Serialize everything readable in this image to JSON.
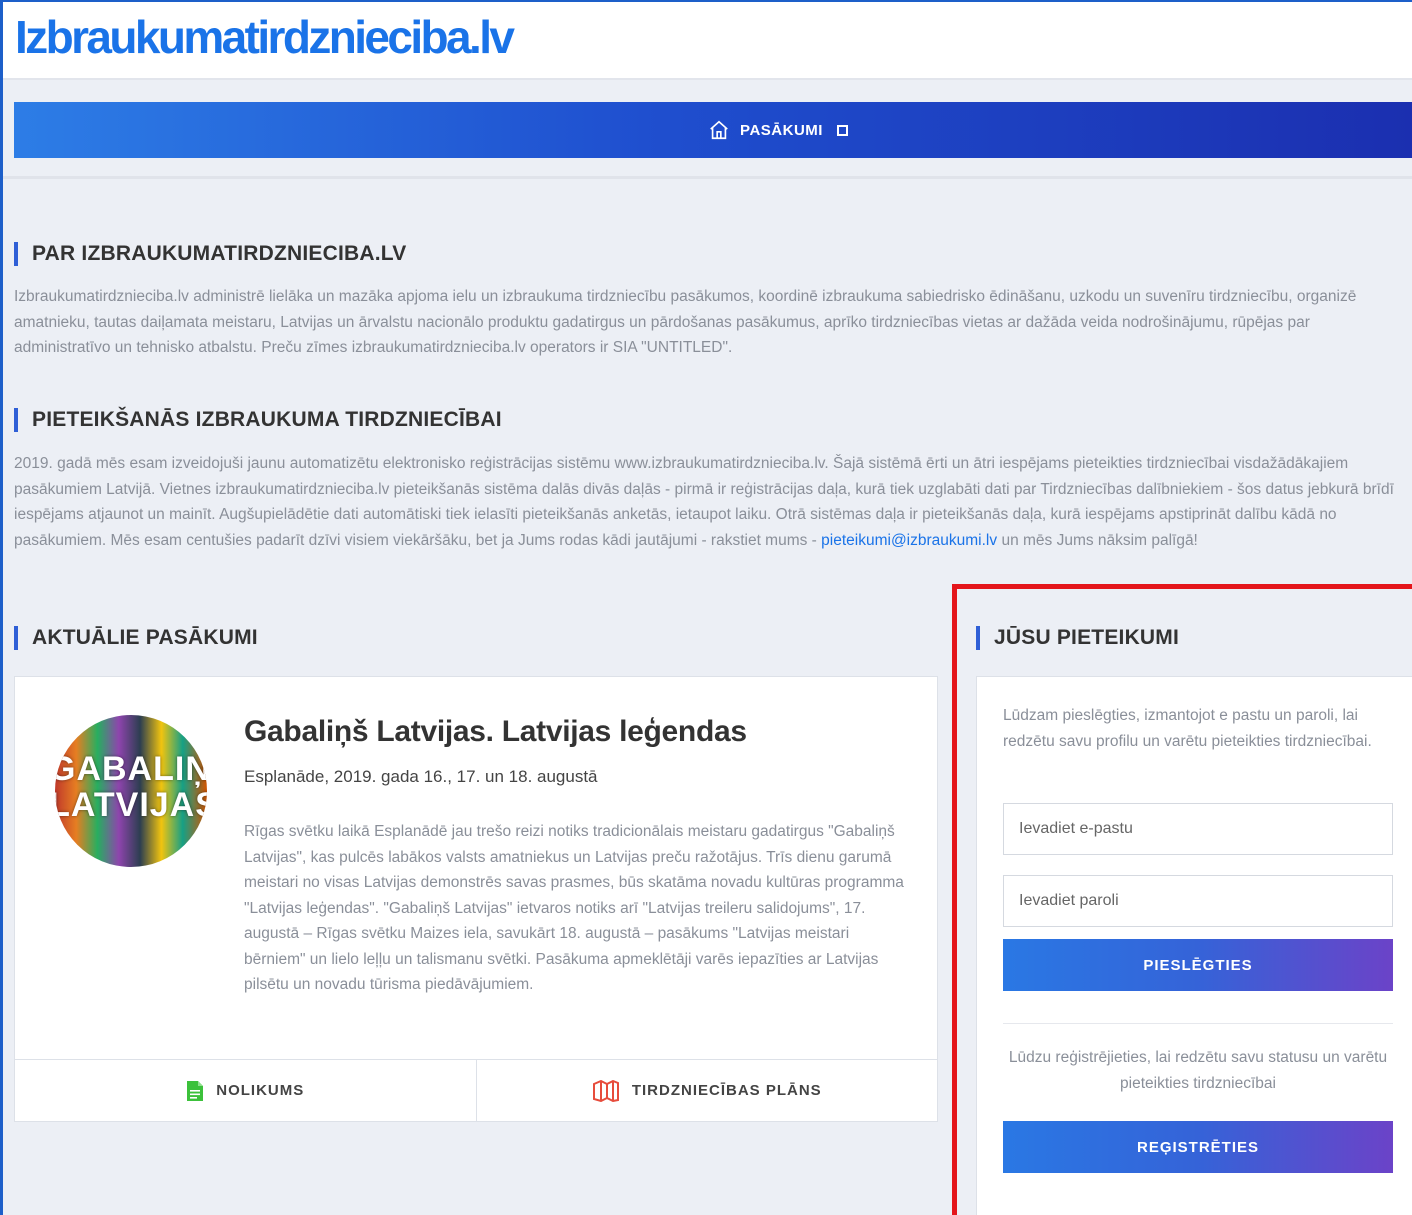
{
  "site": {
    "logo": "Izbraukumatirdznieciba.lv"
  },
  "nav": {
    "items": [
      {
        "label": "PASĀKUMI",
        "icon": "home-icon"
      }
    ]
  },
  "about": {
    "title": "PAR IZBRAUKUMATIRDZNIECIBA.LV",
    "text": "Izbraukumatirdznieciba.lv administrē lielāka un mazāka apjoma ielu un izbraukuma tirdzniecību pasākumos, koordinē izbraukuma sabiedrisko ēdināšanu, uzkodu un suvenīru tirdzniecību, organizē amatnieku, tautas daiļamata meistaru, Latvijas un ārvalstu nacionālo produktu gadatirgus un pārdošanas pasākumus, aprīko tirdzniecības vietas ar dažāda veida nodrošinājumu, rūpējas par administratīvo un tehnisko atbalstu. Preču zīmes izbraukumatirdznieciba.lv operators ir SIA \"UNTITLED\"."
  },
  "signup": {
    "title": "PIETEIKŠANĀS IZBRAUKUMA TIRDZNIECĪBAI",
    "text": "2019. gadā mēs esam izveidojuši jaunu automatizētu elektronisko reģistrācijas sistēmu www.izbraukumatirdznieciba.lv. Šajā sistēmā ērti un ātri iespējams pieteikties tirdzniecībai visdažādākajiem pasākumiem Latvijā. Vietnes izbraukumatirdznieciba.lv pieteikšanās sistēma dalās divās daļās - pirmā ir reģistrācijas daļa, kurā tiek uzglabāti dati par Tirdzniecības dalībniekiem - šos datus jebkurā brīdī iespējams atjaunot un mainīt. Augšupielādētie dati automātiski tiek ielasīti pieteikšanās anketās, ietaupot laiku. Otrā sistēmas daļa ir pieteikšanās daļa, kurā iespējams apstiprināt dalību kādā no pasākumiem. Mēs esam centušies padarīt dzīvi visiem viekāršāku, bet ja Jums rodas kādi jautājumi - rakstiet mums -",
    "email": "pieteikumi@izbraukumi.lv",
    "text_end": "un mēs Jums nāksim palīgā!"
  },
  "events": {
    "title": "AKTUĀLIE PASĀKUMI",
    "items": [
      {
        "image_text": "GABALIŅŠ LATVIJAS",
        "title": "Gabaliņš Latvijas. Latvijas leģendas",
        "subtitle": "Esplanāde, 2019. gada 16., 17. un 18. augustā",
        "description": "Rīgas svētku laikā Esplanādē jau trešo reizi notiks tradicionālais meistaru gadatirgus \"Gabaliņš Latvijas\", kas pulcēs labākos valsts amatniekus un Latvijas preču ražotājus. Trīs dienu garumā meistari no visas Latvijas demonstrēs savas prasmes, būs skatāma novadu kultūras programma \"Latvijas leģendas\". \"Gabaliņš Latvijas\" ietvaros notiks arī \"Latvijas treileru salidojums\", 17. augustā – Rīgas svētku Maizes iela, savukārt 18. augustā – pasākums \"Latvijas meistari bērniem\" un lielo leļļu un talismanu svētki. Pasākuma apmeklētāji varēs iepazīties ar Latvijas pilsētu un novadu tūrisma piedāvājumiem.",
        "actions": [
          {
            "label": "NOLIKUMS",
            "icon": "document-icon",
            "color": "#3cc13b"
          },
          {
            "label": "TIRDZNIECĪBAS PLĀNS",
            "icon": "map-icon",
            "color": "#e74c3c"
          }
        ]
      }
    ]
  },
  "account": {
    "title": "JŪSU PIETEIKUMI",
    "login_text": "Lūdzam pieslēgties, izmantojot e pastu un paroli, lai redzētu savu profilu un varētu pieteikties tirdzniecībai.",
    "email_placeholder": "Ievadiet e-pastu",
    "password_placeholder": "Ievadiet paroli",
    "login_button": "PIESLĒGTIES",
    "register_text": "Lūdzu reģistrējieties, lai redzētu savu statusu un varētu pieteikties tirdzniecībai",
    "register_button": "REĢISTRĒTIES"
  },
  "colors": {
    "accent": "#1a73e8",
    "highlight": "#e4151b"
  }
}
